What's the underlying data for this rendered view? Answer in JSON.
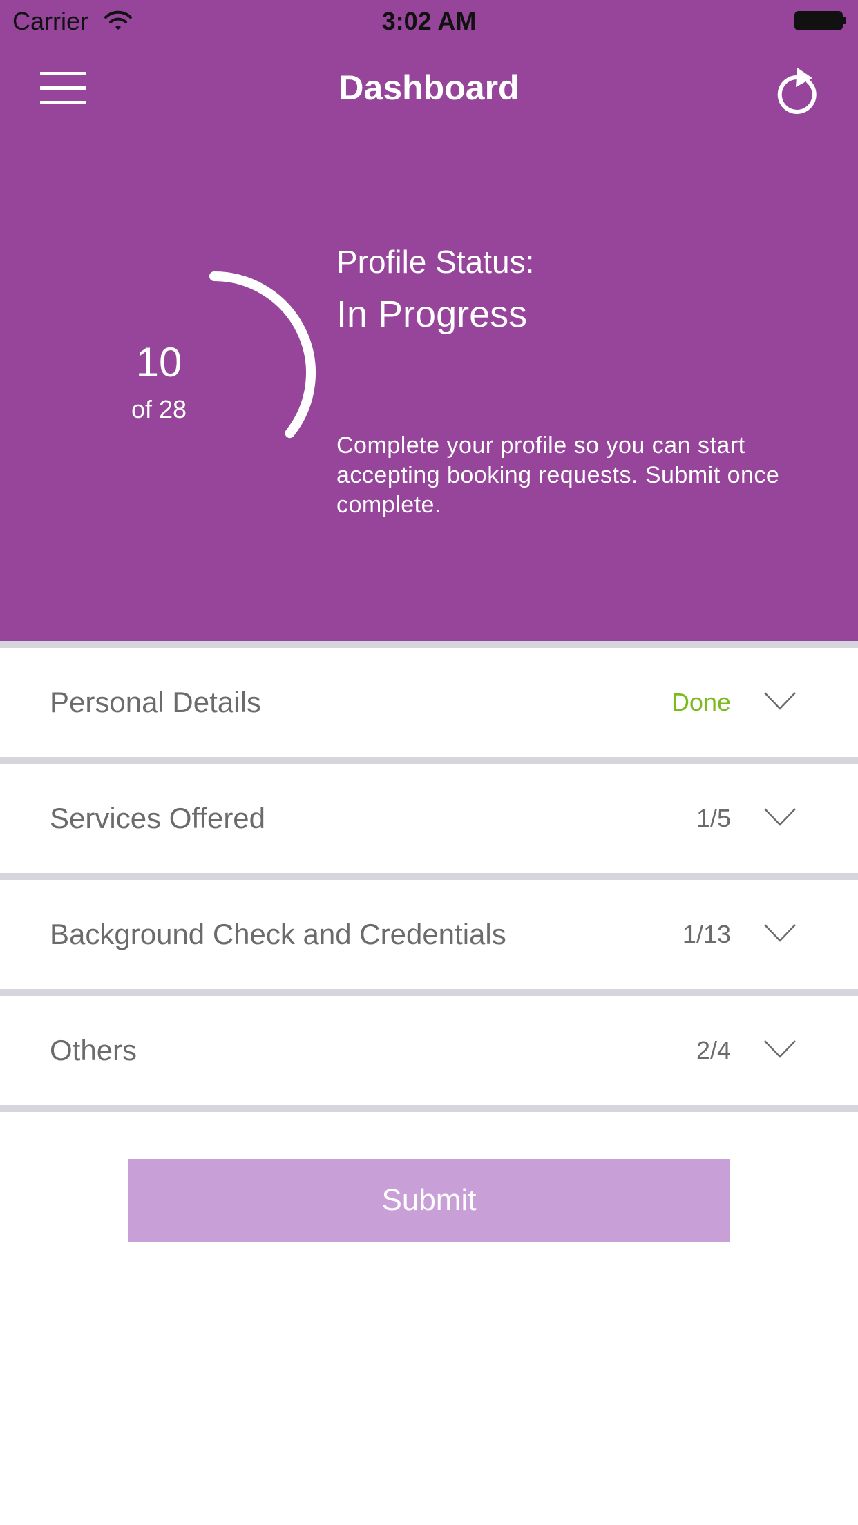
{
  "status_bar": {
    "carrier": "Carrier",
    "time": "3:02 AM"
  },
  "nav": {
    "title": "Dashboard",
    "left_icon": "hamburger-menu-icon",
    "right_icon": "refresh-icon"
  },
  "profile": {
    "completed": "10",
    "total_label": "of 28",
    "progress_fraction": 0.357,
    "status_label": "Profile Status:",
    "status_value": "In Progress",
    "description": "Complete your profile so you can start accepting booking requests. Submit once complete."
  },
  "sections": [
    {
      "title": "Personal Details",
      "status": "Done",
      "is_done": true
    },
    {
      "title": "Services Offered",
      "status": "1/5",
      "is_done": false
    },
    {
      "title": "Background Check and Credentials",
      "status": "1/13",
      "is_done": false
    },
    {
      "title": "Others",
      "status": "2/4",
      "is_done": false
    }
  ],
  "submit": {
    "label": "Submit"
  },
  "colors": {
    "brand_purple": "#96459a",
    "submit_disabled": "#c99fd8",
    "done_green": "#7cbb1e",
    "divider": "#d6d4dc"
  }
}
